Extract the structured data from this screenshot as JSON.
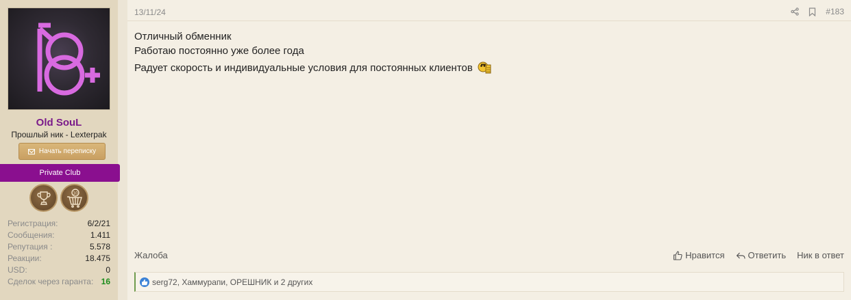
{
  "user": {
    "name": "Old SouL",
    "previous_nick": "Прошлый ник - Lexterpak",
    "pm_button_label": "Начать переписку",
    "group_banner": "Private Club",
    "badges": [
      {
        "name": "trophy-badge"
      },
      {
        "name": "cart-10-badge",
        "label": "10"
      }
    ],
    "stats": [
      {
        "label": "Регистрация:",
        "value": "6/2/21"
      },
      {
        "label": "Сообщения:",
        "value": "1.411"
      },
      {
        "label": "Репутация :",
        "value": "5.578"
      },
      {
        "label": "Реакции:",
        "value": "18.475"
      },
      {
        "label": "USD:",
        "value": "0"
      },
      {
        "label": "Сделок через гаранта:",
        "value": "16"
      }
    ],
    "avatar_text": "18+",
    "colors": {
      "name": "#7a1a8a",
      "banner": "#8a0f8f",
      "avatar_symbol": "#d86ae0"
    }
  },
  "post": {
    "date": "13/11/24",
    "number": "#183",
    "lines": [
      "Отличный обменник",
      "Работаю постоянно уже более года",
      "Радует скорость и индивидуальные условия для постоянных клиентов"
    ],
    "report_label": "Жалоба",
    "like_label": "Нравится",
    "reply_label": "Ответить",
    "nick_reply_label": "Ник в ответ",
    "reactions_text": "serg72, Хаммурапи, ОРЕШНИК и 2 других"
  }
}
